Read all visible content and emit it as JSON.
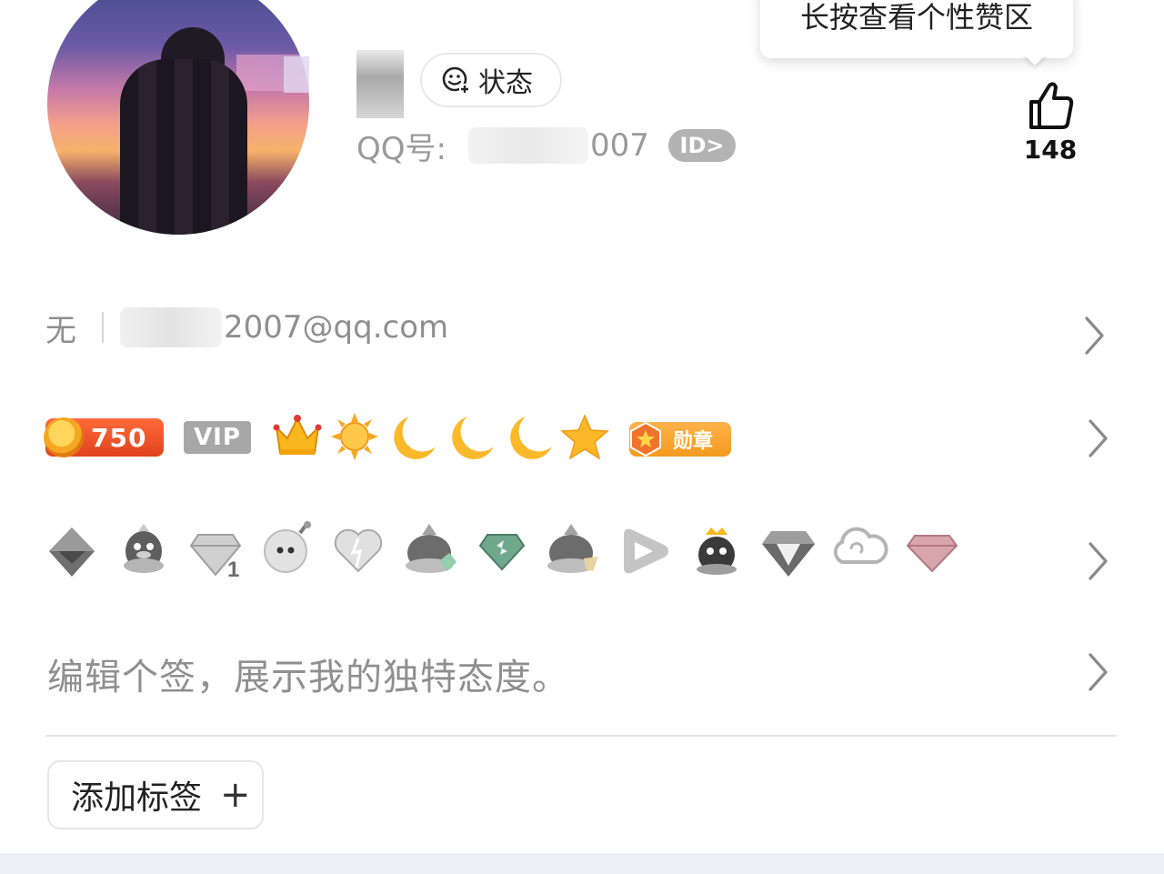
{
  "tooltip": {
    "text": "长按查看个性赞区"
  },
  "profile": {
    "status_label": "状态",
    "qq_label": "QQ号:",
    "qq_tail": "007",
    "id_badge": "ID>",
    "likes": "148"
  },
  "contact": {
    "gender": "无",
    "email_suffix": "2007@qq.com"
  },
  "badges": {
    "level": "750",
    "vip": "VIP",
    "medal": "勋章",
    "icons": [
      "crown-icon",
      "sun-icon",
      "moon-icon",
      "moon-icon",
      "moon-icon",
      "star-icon"
    ]
  },
  "gray_icons": [
    "diamond-bird-icon",
    "penguin-icon",
    "diamond-1-icon",
    "bomb-face-icon",
    "heart-icon",
    "mountain-icon",
    "green-diamond-icon",
    "mountain-flower-icon",
    "play-icon",
    "penguin-crown-icon",
    "gray-diamond-icon",
    "cloud-icon",
    "pink-diamond-icon"
  ],
  "signature": {
    "placeholder": "编辑个签，展示我的独特态度。"
  },
  "tags": {
    "add_label": "添加标签"
  }
}
